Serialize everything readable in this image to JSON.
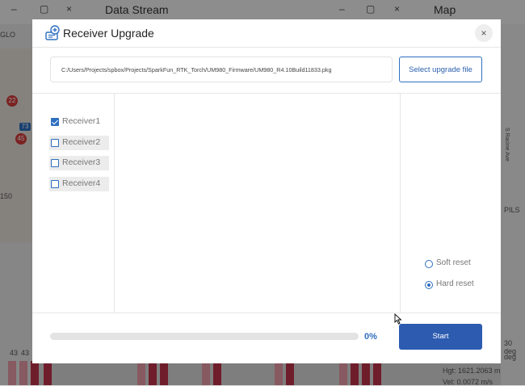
{
  "background": {
    "window_titles": [
      "Data Stream",
      "Map"
    ],
    "left_labels": [
      "GLO",
      "150"
    ],
    "badges": [
      "22",
      "45",
      "73"
    ],
    "bottom_labels": [
      "43",
      "43"
    ],
    "right_labels": [
      "S Racine Ave",
      "PILS"
    ],
    "status_lines": [
      "30 deg",
      "deg",
      "Hgt: 1621.2063 m",
      "Vel: 0.0072 m/s"
    ]
  },
  "dialog": {
    "title": "Receiver Upgrade",
    "close_glyph": "×",
    "file_path": "C:/Users/Projects/spbox/Projects/SparkFun_RTK_Torch/UM980_Firmware/UM980_R4.10Build11833.pkg",
    "select_button": "Select upgrade file",
    "receivers": [
      {
        "label": "Receiver1",
        "checked": true
      },
      {
        "label": "Receiver2",
        "checked": false
      },
      {
        "label": "Receiver3",
        "checked": false
      },
      {
        "label": "Receiver4",
        "checked": false
      }
    ],
    "reset_options": [
      {
        "label": "Soft reset",
        "selected": false
      },
      {
        "label": "Hard reset",
        "selected": true
      }
    ],
    "progress": {
      "value": 0,
      "label": "0%"
    },
    "start_button": "Start"
  },
  "colors": {
    "accent": "#2e6fc0",
    "start_button": "#2c5bb0"
  }
}
